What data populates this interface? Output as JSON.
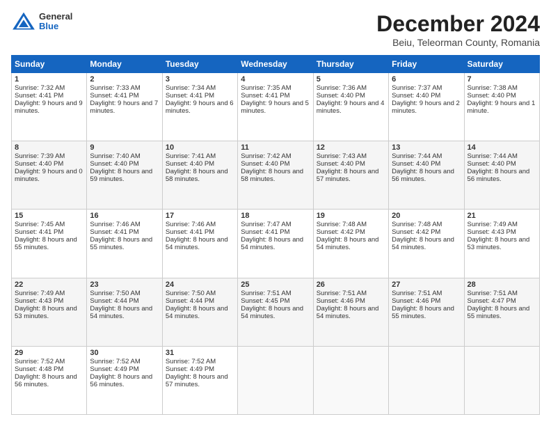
{
  "logo": {
    "general": "General",
    "blue": "Blue"
  },
  "title": "December 2024",
  "subtitle": "Beiu, Teleorman County, Romania",
  "days": [
    "Sunday",
    "Monday",
    "Tuesday",
    "Wednesday",
    "Thursday",
    "Friday",
    "Saturday"
  ],
  "weeks": [
    [
      {
        "day": 1,
        "sunrise": "7:32 AM",
        "sunset": "4:41 PM",
        "daylight": "9 hours and 9 minutes."
      },
      {
        "day": 2,
        "sunrise": "7:33 AM",
        "sunset": "4:41 PM",
        "daylight": "9 hours and 7 minutes."
      },
      {
        "day": 3,
        "sunrise": "7:34 AM",
        "sunset": "4:41 PM",
        "daylight": "9 hours and 6 minutes."
      },
      {
        "day": 4,
        "sunrise": "7:35 AM",
        "sunset": "4:41 PM",
        "daylight": "9 hours and 5 minutes."
      },
      {
        "day": 5,
        "sunrise": "7:36 AM",
        "sunset": "4:40 PM",
        "daylight": "9 hours and 4 minutes."
      },
      {
        "day": 6,
        "sunrise": "7:37 AM",
        "sunset": "4:40 PM",
        "daylight": "9 hours and 2 minutes."
      },
      {
        "day": 7,
        "sunrise": "7:38 AM",
        "sunset": "4:40 PM",
        "daylight": "9 hours and 1 minute."
      }
    ],
    [
      {
        "day": 8,
        "sunrise": "7:39 AM",
        "sunset": "4:40 PM",
        "daylight": "9 hours and 0 minutes."
      },
      {
        "day": 9,
        "sunrise": "7:40 AM",
        "sunset": "4:40 PM",
        "daylight": "8 hours and 59 minutes."
      },
      {
        "day": 10,
        "sunrise": "7:41 AM",
        "sunset": "4:40 PM",
        "daylight": "8 hours and 58 minutes."
      },
      {
        "day": 11,
        "sunrise": "7:42 AM",
        "sunset": "4:40 PM",
        "daylight": "8 hours and 58 minutes."
      },
      {
        "day": 12,
        "sunrise": "7:43 AM",
        "sunset": "4:40 PM",
        "daylight": "8 hours and 57 minutes."
      },
      {
        "day": 13,
        "sunrise": "7:44 AM",
        "sunset": "4:40 PM",
        "daylight": "8 hours and 56 minutes."
      },
      {
        "day": 14,
        "sunrise": "7:44 AM",
        "sunset": "4:40 PM",
        "daylight": "8 hours and 56 minutes."
      }
    ],
    [
      {
        "day": 15,
        "sunrise": "7:45 AM",
        "sunset": "4:41 PM",
        "daylight": "8 hours and 55 minutes."
      },
      {
        "day": 16,
        "sunrise": "7:46 AM",
        "sunset": "4:41 PM",
        "daylight": "8 hours and 55 minutes."
      },
      {
        "day": 17,
        "sunrise": "7:46 AM",
        "sunset": "4:41 PM",
        "daylight": "8 hours and 54 minutes."
      },
      {
        "day": 18,
        "sunrise": "7:47 AM",
        "sunset": "4:41 PM",
        "daylight": "8 hours and 54 minutes."
      },
      {
        "day": 19,
        "sunrise": "7:48 AM",
        "sunset": "4:42 PM",
        "daylight": "8 hours and 54 minutes."
      },
      {
        "day": 20,
        "sunrise": "7:48 AM",
        "sunset": "4:42 PM",
        "daylight": "8 hours and 54 minutes."
      },
      {
        "day": 21,
        "sunrise": "7:49 AM",
        "sunset": "4:43 PM",
        "daylight": "8 hours and 53 minutes."
      }
    ],
    [
      {
        "day": 22,
        "sunrise": "7:49 AM",
        "sunset": "4:43 PM",
        "daylight": "8 hours and 53 minutes."
      },
      {
        "day": 23,
        "sunrise": "7:50 AM",
        "sunset": "4:44 PM",
        "daylight": "8 hours and 54 minutes."
      },
      {
        "day": 24,
        "sunrise": "7:50 AM",
        "sunset": "4:44 PM",
        "daylight": "8 hours and 54 minutes."
      },
      {
        "day": 25,
        "sunrise": "7:51 AM",
        "sunset": "4:45 PM",
        "daylight": "8 hours and 54 minutes."
      },
      {
        "day": 26,
        "sunrise": "7:51 AM",
        "sunset": "4:46 PM",
        "daylight": "8 hours and 54 minutes."
      },
      {
        "day": 27,
        "sunrise": "7:51 AM",
        "sunset": "4:46 PM",
        "daylight": "8 hours and 55 minutes."
      },
      {
        "day": 28,
        "sunrise": "7:51 AM",
        "sunset": "4:47 PM",
        "daylight": "8 hours and 55 minutes."
      }
    ],
    [
      {
        "day": 29,
        "sunrise": "7:52 AM",
        "sunset": "4:48 PM",
        "daylight": "8 hours and 56 minutes."
      },
      {
        "day": 30,
        "sunrise": "7:52 AM",
        "sunset": "4:49 PM",
        "daylight": "8 hours and 56 minutes."
      },
      {
        "day": 31,
        "sunrise": "7:52 AM",
        "sunset": "4:49 PM",
        "daylight": "8 hours and 57 minutes."
      },
      null,
      null,
      null,
      null
    ]
  ]
}
